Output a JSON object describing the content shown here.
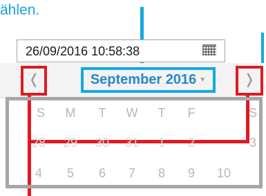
{
  "caption": "ählen.",
  "datetime_input": {
    "value": "26/09/2016 10:58:38",
    "icon": "calendar-grid-icon"
  },
  "calendar": {
    "prev_label": "❬",
    "next_label": "❭",
    "month_label": "September 2016",
    "month_dropdown_icon": "caret-down-icon",
    "weekdays": [
      "S",
      "M",
      "T",
      "W",
      "T",
      "F",
      "S"
    ],
    "week_rows": [
      [
        "28",
        "29",
        "30",
        "31",
        "1",
        "2",
        "3"
      ],
      [
        "4",
        "5",
        "6",
        "7",
        "8",
        "9",
        "10"
      ]
    ]
  },
  "annotation_colors": {
    "blue": "#13a8e0",
    "red": "#e01a22",
    "grey": "#a6a6a6"
  }
}
